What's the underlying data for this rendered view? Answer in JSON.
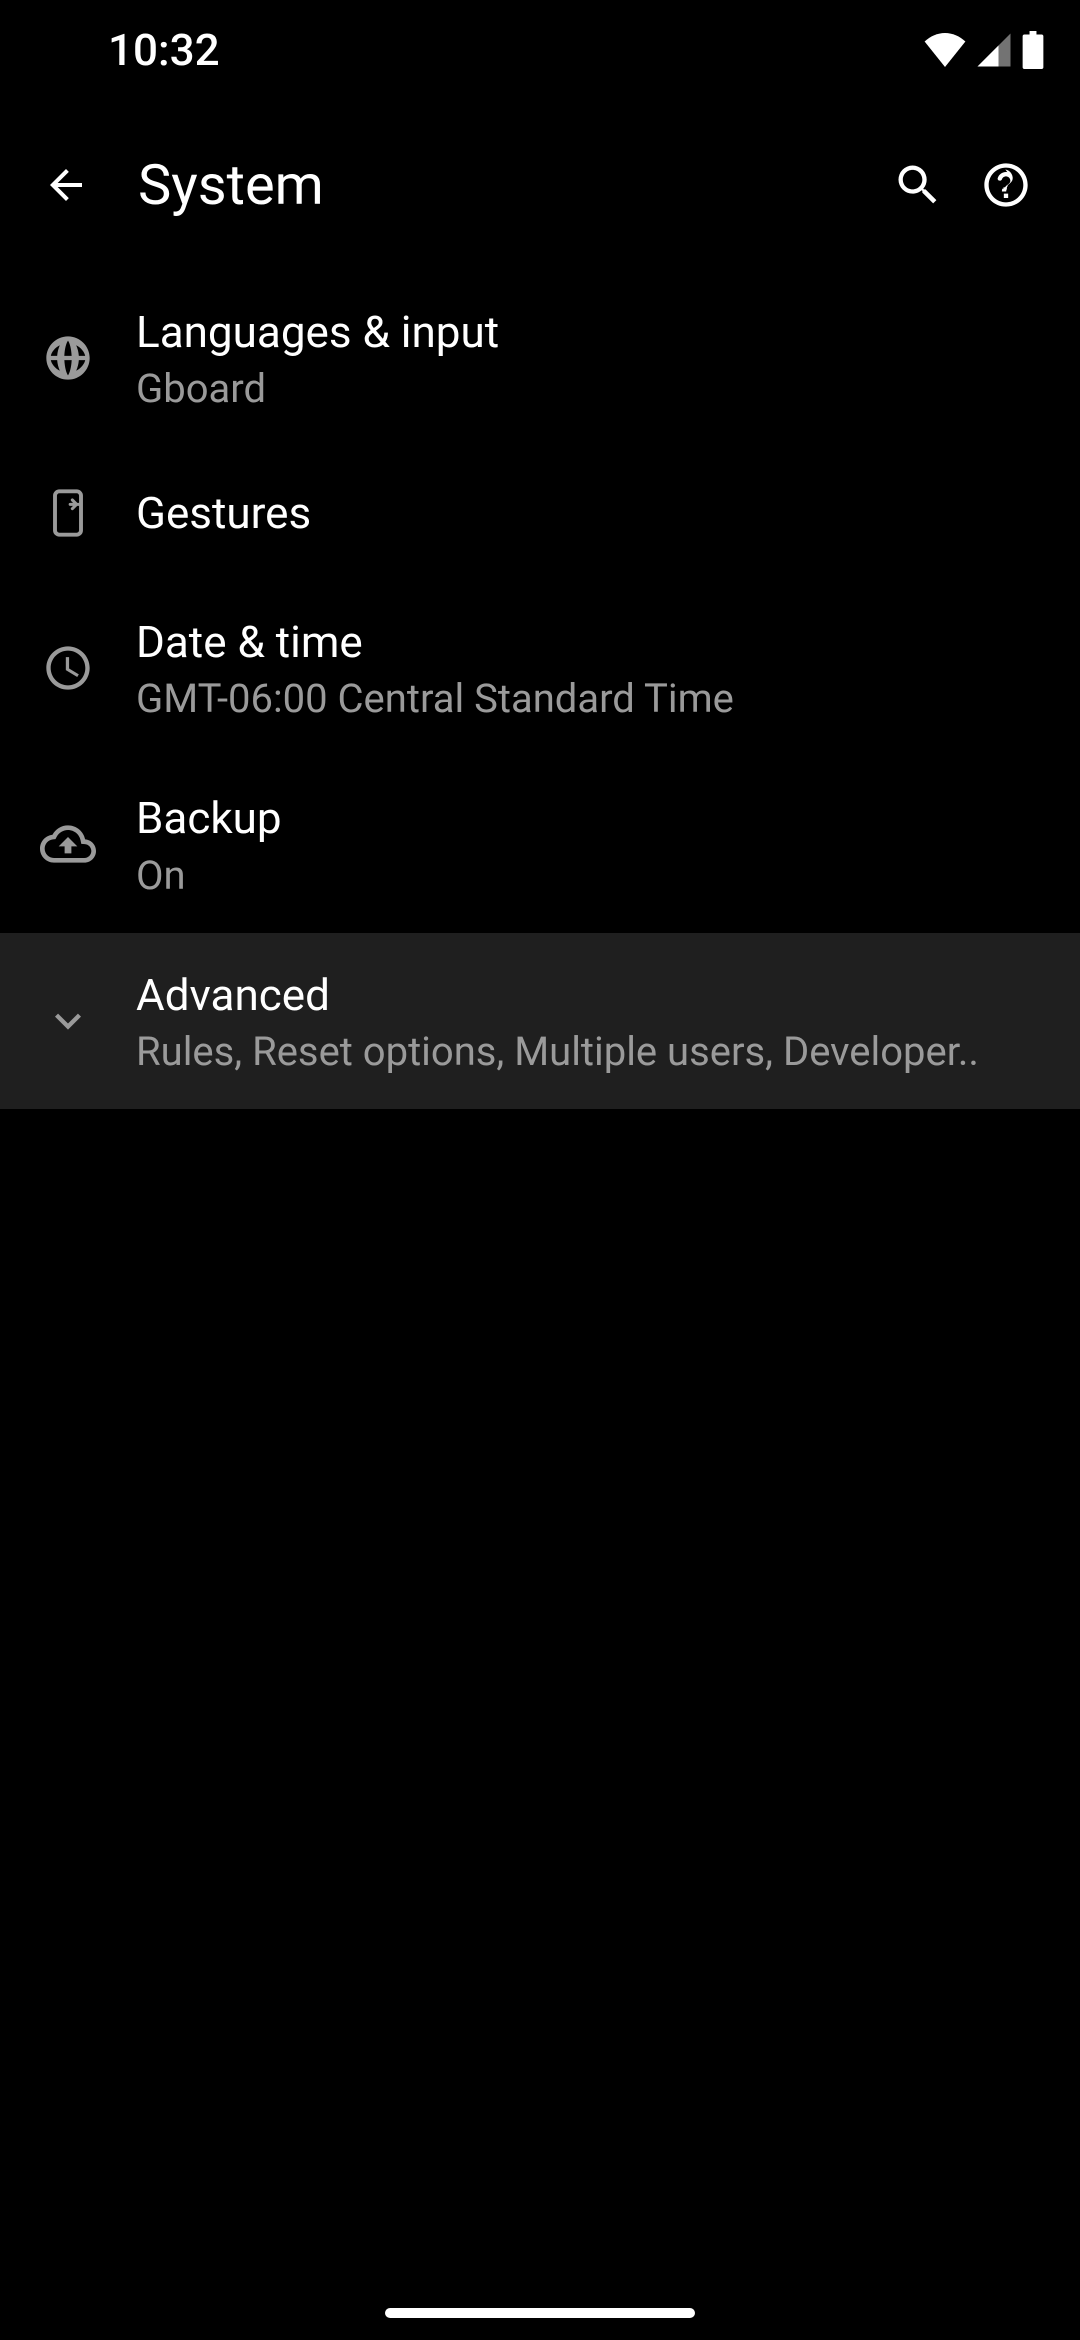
{
  "status": {
    "time": "10:32"
  },
  "header": {
    "title": "System"
  },
  "items": [
    {
      "title": "Languages & input",
      "subtitle": "Gboard"
    },
    {
      "title": "Gestures",
      "subtitle": ""
    },
    {
      "title": "Date & time",
      "subtitle": "GMT-06:00 Central Standard Time"
    },
    {
      "title": "Backup",
      "subtitle": "On"
    },
    {
      "title": "Advanced",
      "subtitle": "Rules, Reset options, Multiple users, Developer.."
    }
  ]
}
